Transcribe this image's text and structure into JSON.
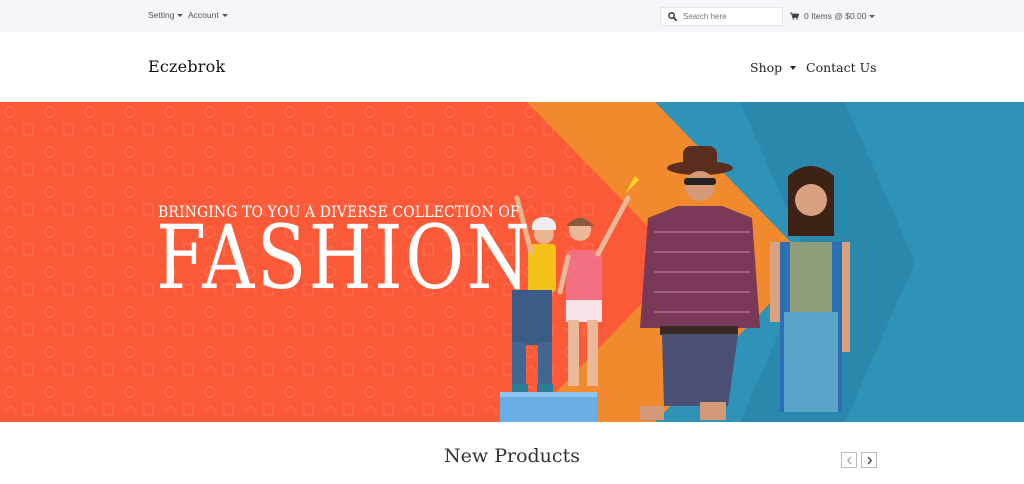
{
  "topbar": {
    "setting_label": "Setting",
    "account_label": "Account",
    "search_placeholder": "Search here",
    "cart_label": "0 Items @ $0.00"
  },
  "header": {
    "brand": "Eczebrok",
    "nav": [
      {
        "label": "Shop"
      },
      {
        "label": "Contact Us"
      }
    ]
  },
  "banner": {
    "tagline": "BRINGING TO YOU A DIVERSE COLLECTION OF",
    "headline": "FASHION",
    "colors": {
      "orange_red": "#fb5a39",
      "orange": "#f08a2c",
      "blue": "#2f93b8"
    }
  },
  "main": {
    "section_title": "New Products"
  },
  "icons": [
    "search-icon",
    "cart-icon",
    "chevron-left-icon",
    "chevron-right-icon"
  ]
}
